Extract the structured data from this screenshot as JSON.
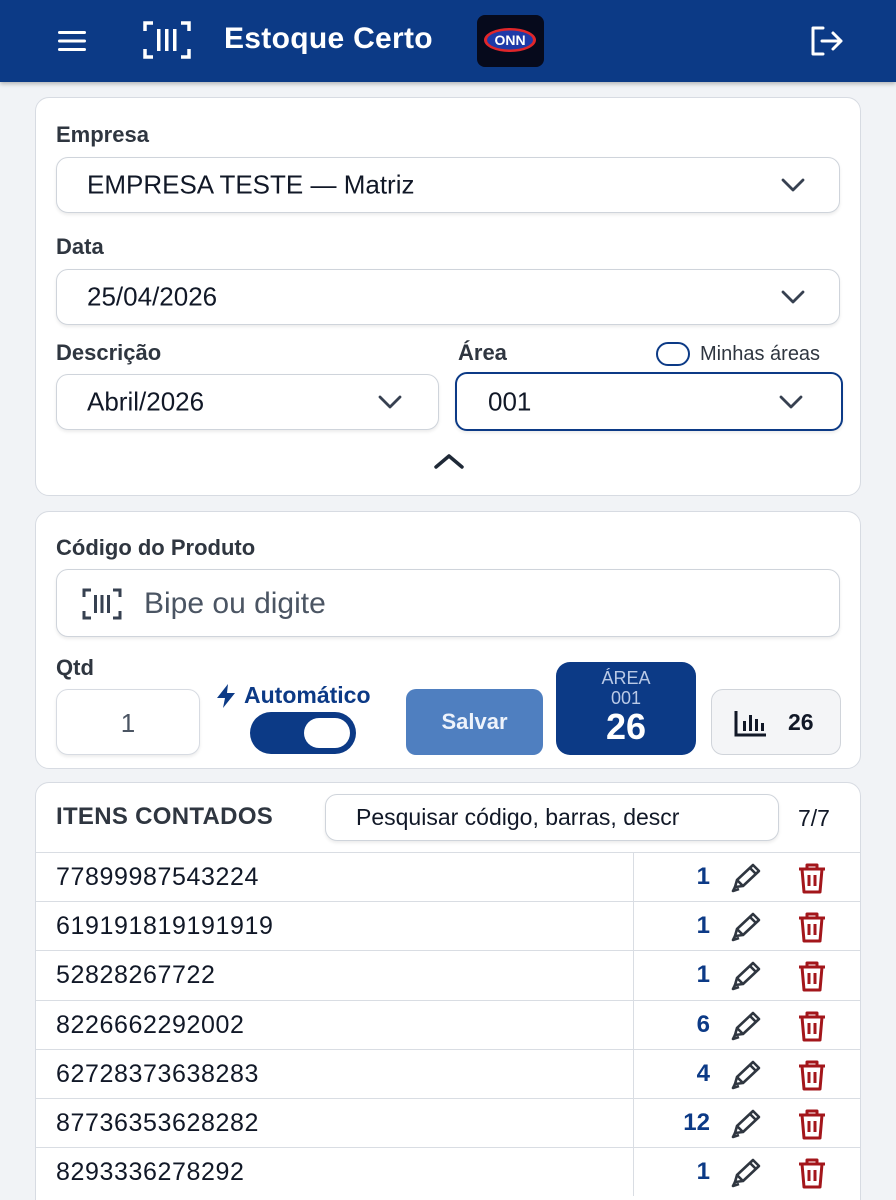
{
  "header": {
    "title": "Estoque Certo",
    "brand_logo_text": "ONN",
    "icons": {
      "menu": "menu-icon",
      "scan": "barcode-scan-icon",
      "logout": "logout-icon"
    },
    "background_color": "#0c3a86"
  },
  "filters": {
    "empresa_label": "Empresa",
    "empresa_value": "EMPRESA TESTE — Matriz",
    "data_label": "Data",
    "data_value": "25/04/2026",
    "descricao_label": "Descrição",
    "descricao_value": "Abril/2026",
    "area_label": "Área",
    "area_value": "001",
    "minhas_areas_label": "Minhas áreas",
    "minhas_areas_checked": false
  },
  "entry": {
    "codigo_label": "Código do Produto",
    "codigo_placeholder": "Bipe ou digite",
    "qtd_label": "Qtd",
    "qtd_value": "1",
    "automatico_label": "Automático",
    "automatico_on": true,
    "save_label": "Salvar",
    "area_box": {
      "line1": "ÁREA",
      "line2": "001",
      "count": "26"
    },
    "stats_count": "26"
  },
  "items": {
    "title": "ITENS CONTADOS",
    "search_placeholder": "Pesquisar código, barras, descr",
    "count": "7/7",
    "rows": [
      {
        "code": "77899987543224",
        "qty": "1"
      },
      {
        "code": "619191819191919",
        "qty": "1"
      },
      {
        "code": "52828267722",
        "qty": "1"
      },
      {
        "code": "8226662292002",
        "qty": "6"
      },
      {
        "code": "62728373638283",
        "qty": "4"
      },
      {
        "code": "87736353628282",
        "qty": "12"
      },
      {
        "code": "8293336278292",
        "qty": "1"
      }
    ]
  },
  "colors": {
    "primary": "#0c3a86",
    "save_button": "#4f7fc0",
    "delete": "#a3161b"
  }
}
